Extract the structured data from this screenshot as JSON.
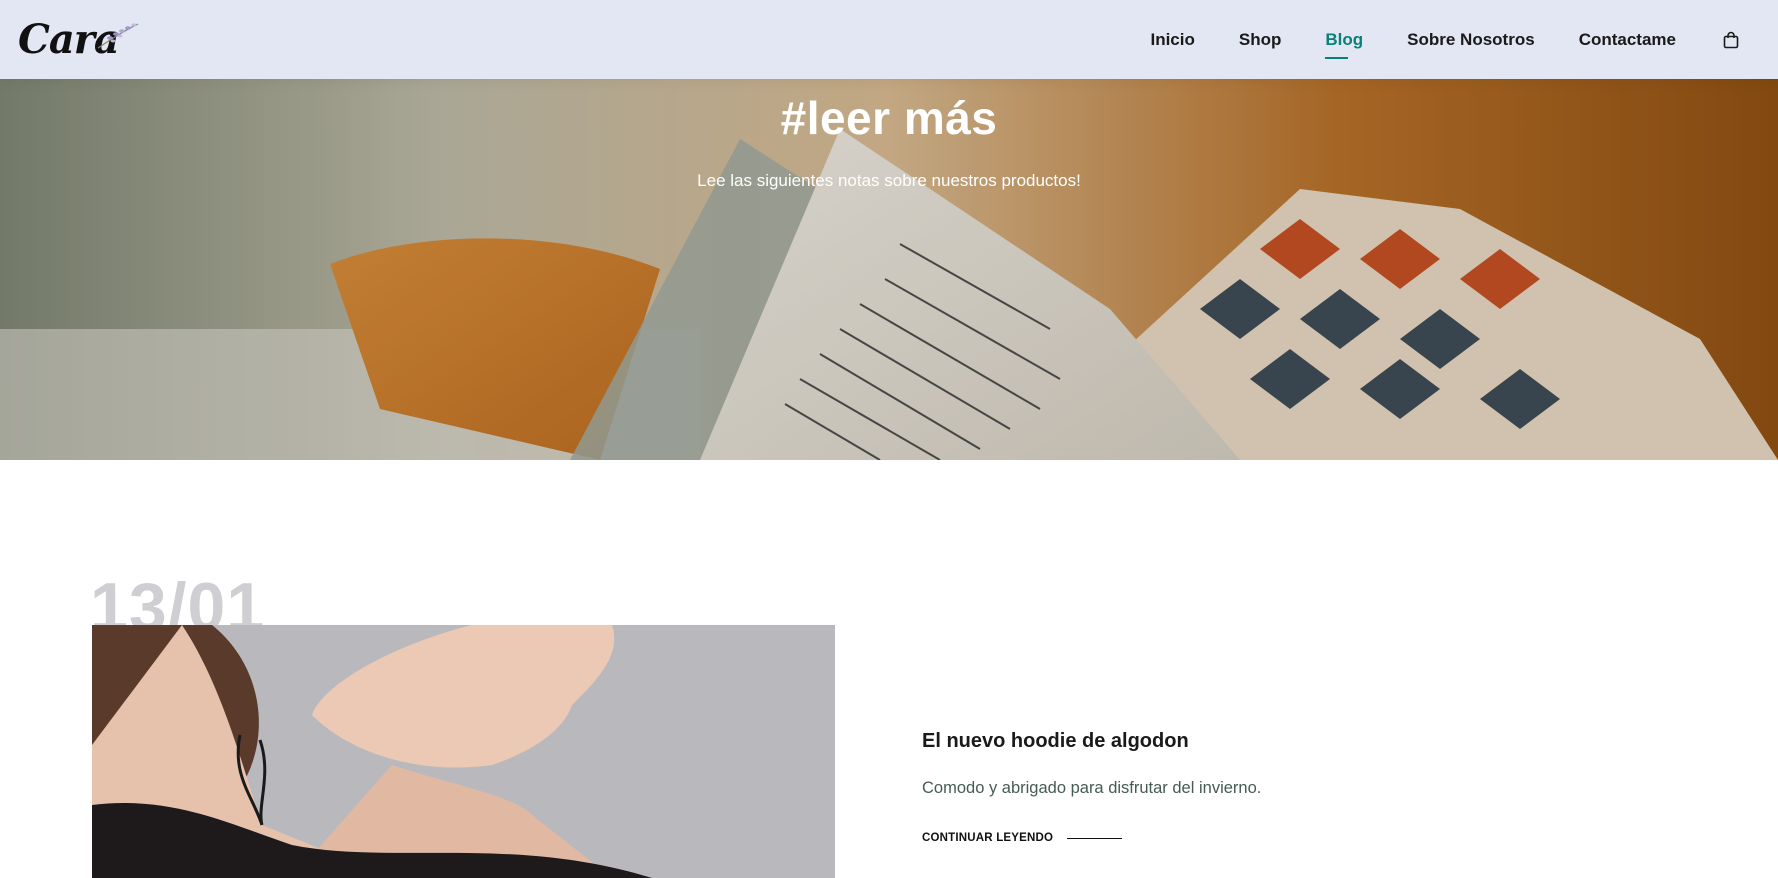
{
  "brand": {
    "logo_text": "Cara"
  },
  "nav": {
    "items": [
      {
        "label": "Inicio",
        "active": false
      },
      {
        "label": "Shop",
        "active": false
      },
      {
        "label": "Blog",
        "active": true
      },
      {
        "label": "Sobre Nosotros",
        "active": false
      },
      {
        "label": "Contactame",
        "active": false
      }
    ],
    "cart_icon": "shopping-bag-icon"
  },
  "hero": {
    "title": "#leer más",
    "subtitle": "Lee las siguientes notas sobre nuestros productos!"
  },
  "blog": {
    "posts": [
      {
        "date": "13/01",
        "title": "El nuevo hoodie de algodon",
        "excerpt": "Comodo y abrigado para disfrutar del invierno.",
        "cta": "CONTINUAR LEYENDO"
      }
    ]
  },
  "colors": {
    "accent": "#088178",
    "header_bg": "#e3e6f3",
    "date_gray": "#cfcfd3"
  }
}
